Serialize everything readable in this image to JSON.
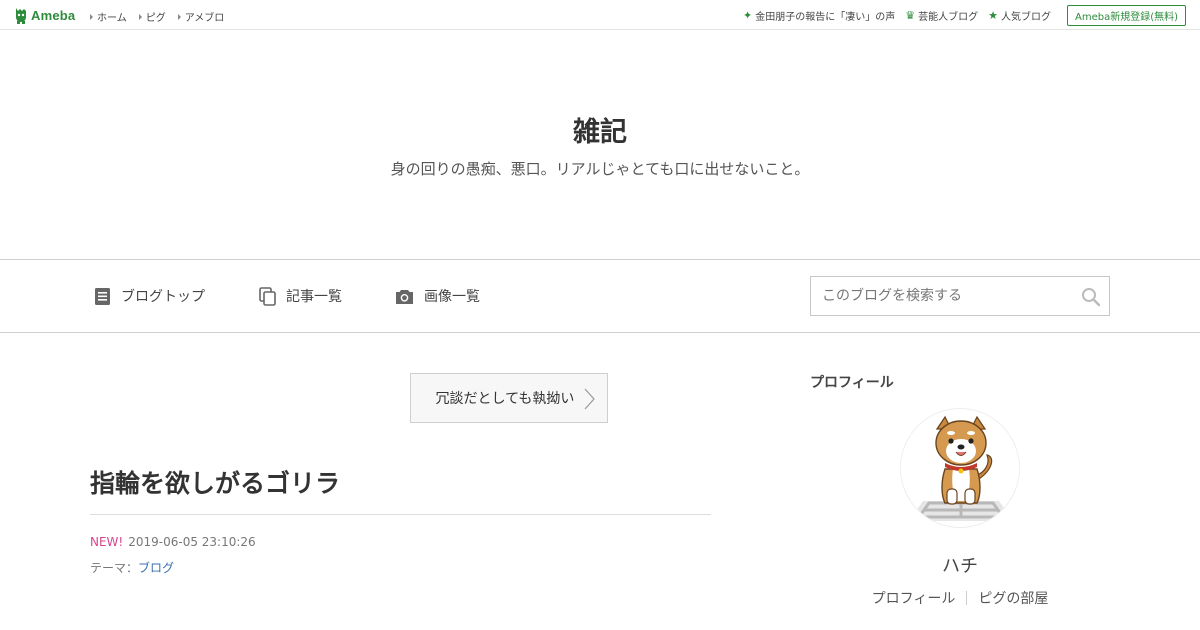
{
  "topbar": {
    "logo_text": "Ameba",
    "nav": [
      {
        "label": "ホーム"
      },
      {
        "label": "ピグ"
      },
      {
        "label": "アメブロ"
      }
    ],
    "right": [
      {
        "icon": "sparkle-icon",
        "label": "金田朋子の報告に「凄い」の声"
      },
      {
        "icon": "crown-icon",
        "label": "芸能人ブログ"
      },
      {
        "icon": "star-icon",
        "label": "人気ブログ"
      }
    ],
    "signup_label": "Ameba新規登録(無料)",
    "accent_color": "#2d8c3c"
  },
  "header": {
    "title": "雑記",
    "description": "身の回りの愚痴、悪口。リアルじゃとても口に出せないこと。"
  },
  "navbar": {
    "items": [
      {
        "icon": "document-icon",
        "label": "ブログトップ"
      },
      {
        "icon": "copy-icon",
        "label": "記事一覧"
      },
      {
        "icon": "camera-icon",
        "label": "画像一覧"
      }
    ],
    "search_placeholder": "このブログを検索する"
  },
  "main": {
    "prev_article_label": "冗談だとしても執拗い",
    "article": {
      "title": "指輪を欲しがるゴリラ",
      "new_badge": "NEW!",
      "datetime": "2019-06-05 23:10:26",
      "theme_label": "テーマ：",
      "theme_value": "ブログ"
    }
  },
  "sidebar": {
    "heading": "プロフィール",
    "profile_name": "ハチ",
    "links": [
      {
        "label": "プロフィール"
      },
      {
        "label": "ピグの部屋"
      }
    ]
  }
}
